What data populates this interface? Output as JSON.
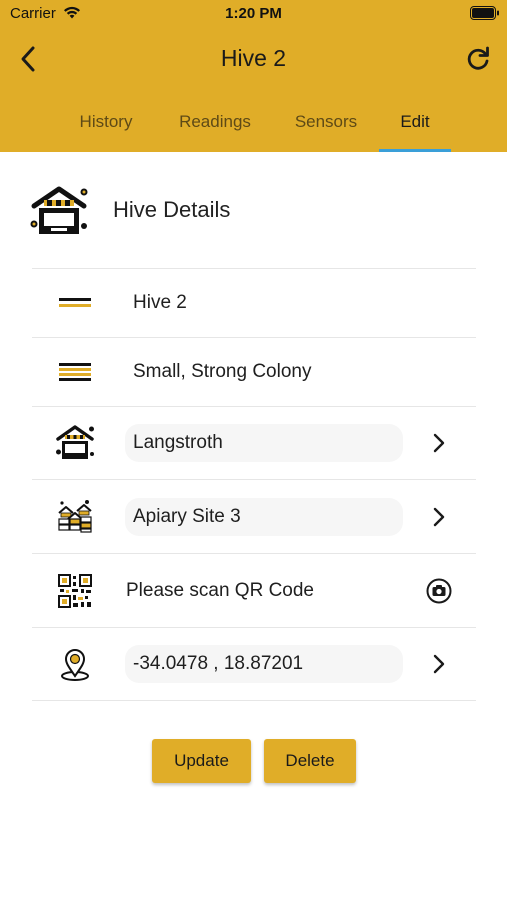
{
  "status_bar": {
    "carrier": "Carrier",
    "time": "1:20 PM"
  },
  "header": {
    "title": "Hive 2",
    "background_color": "#E0AD28"
  },
  "tabs": [
    {
      "label": "History",
      "active": false
    },
    {
      "label": "Readings",
      "active": false
    },
    {
      "label": "Sensors",
      "active": false
    },
    {
      "label": "Edit",
      "active": true
    }
  ],
  "section": {
    "title": "Hive Details",
    "icon": "hive-box-icon"
  },
  "rows": [
    {
      "icon": "single-line-icon",
      "value": "Hive 2"
    },
    {
      "icon": "stacked-lines-icon",
      "value": "Small, Strong Colony"
    },
    {
      "icon": "hive-box-icon",
      "value": "Langstroth"
    },
    {
      "icon": "apiary-icon",
      "value": "Apiary Site 3"
    },
    {
      "icon": "qr-code-icon",
      "value": "Please scan QR Code"
    },
    {
      "icon": "location-pin-icon",
      "value": "-34.0478 , 18.87201"
    }
  ],
  "buttons": {
    "update": "Update",
    "delete": "Delete"
  },
  "colors": {
    "accent": "#E0AD28",
    "tab_indicator": "#3a9fd8"
  }
}
